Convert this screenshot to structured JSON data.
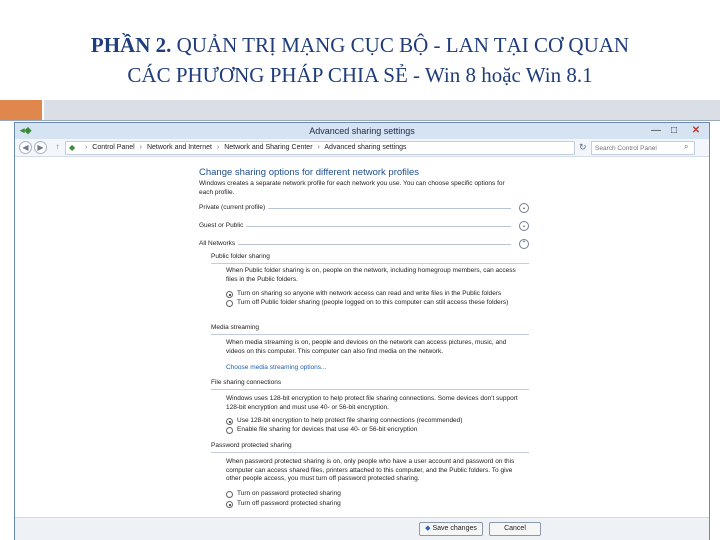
{
  "slide": {
    "title_part1": "PHẦN 2.",
    "title_part2": " QUẢN TRỊ MẠNG CỤC BỘ - LAN TẠI CƠ QUAN",
    "title_line2": "CÁC PHƯƠNG PHÁP CHIA SẺ - Win 8 hoặc Win 8.1"
  },
  "window": {
    "title": "Advanced sharing settings",
    "minimize": "—",
    "maximize": "□",
    "close": "✕"
  },
  "address": {
    "crumbs": [
      "Control Panel",
      "Network and Internet",
      "Network and Sharing Center",
      "Advanced sharing settings"
    ],
    "search_placeholder": "Search Control Panel"
  },
  "content": {
    "heading": "Change sharing options for different network profiles",
    "intro": "Windows creates a separate network profile for each network you use. You can choose specific options for each profile.",
    "profiles": {
      "private": "Private (current profile)",
      "guest": "Guest or Public",
      "all": "All Networks"
    },
    "public_folder": {
      "title": "Public folder sharing",
      "desc": "When Public folder sharing is on, people on the network, including homegroup members, can access files in the Public folders.",
      "opt_on": "Turn on sharing so anyone with network access can read and write files in the Public folders",
      "opt_off": "Turn off Public folder sharing (people logged on to this computer can still access these folders)"
    },
    "media": {
      "title": "Media streaming",
      "desc": "When media streaming is on, people and devices on the network can access pictures, music, and videos on this computer. This computer can also find media on the network.",
      "link": "Choose media streaming options..."
    },
    "file_sharing": {
      "title": "File sharing connections",
      "desc": "Windows uses 128-bit encryption to help protect file sharing connections. Some devices don't support 128-bit encryption and must use 40- or 56-bit encryption.",
      "opt_128": "Use 128-bit encryption to help protect file sharing connections (recommended)",
      "opt_40": "Enable file sharing for devices that use 40- or 56-bit encryption"
    },
    "password": {
      "title": "Password protected sharing",
      "desc": "When password protected sharing is on, only people who have a user account and password on this computer can access shared files, printers attached to this computer, and the Public folders. To give other people access, you must turn off password protected sharing.",
      "opt_on": "Turn on password protected sharing",
      "opt_off": "Turn off password protected sharing"
    }
  },
  "footer": {
    "save": "Save changes",
    "cancel": "Cancel"
  }
}
